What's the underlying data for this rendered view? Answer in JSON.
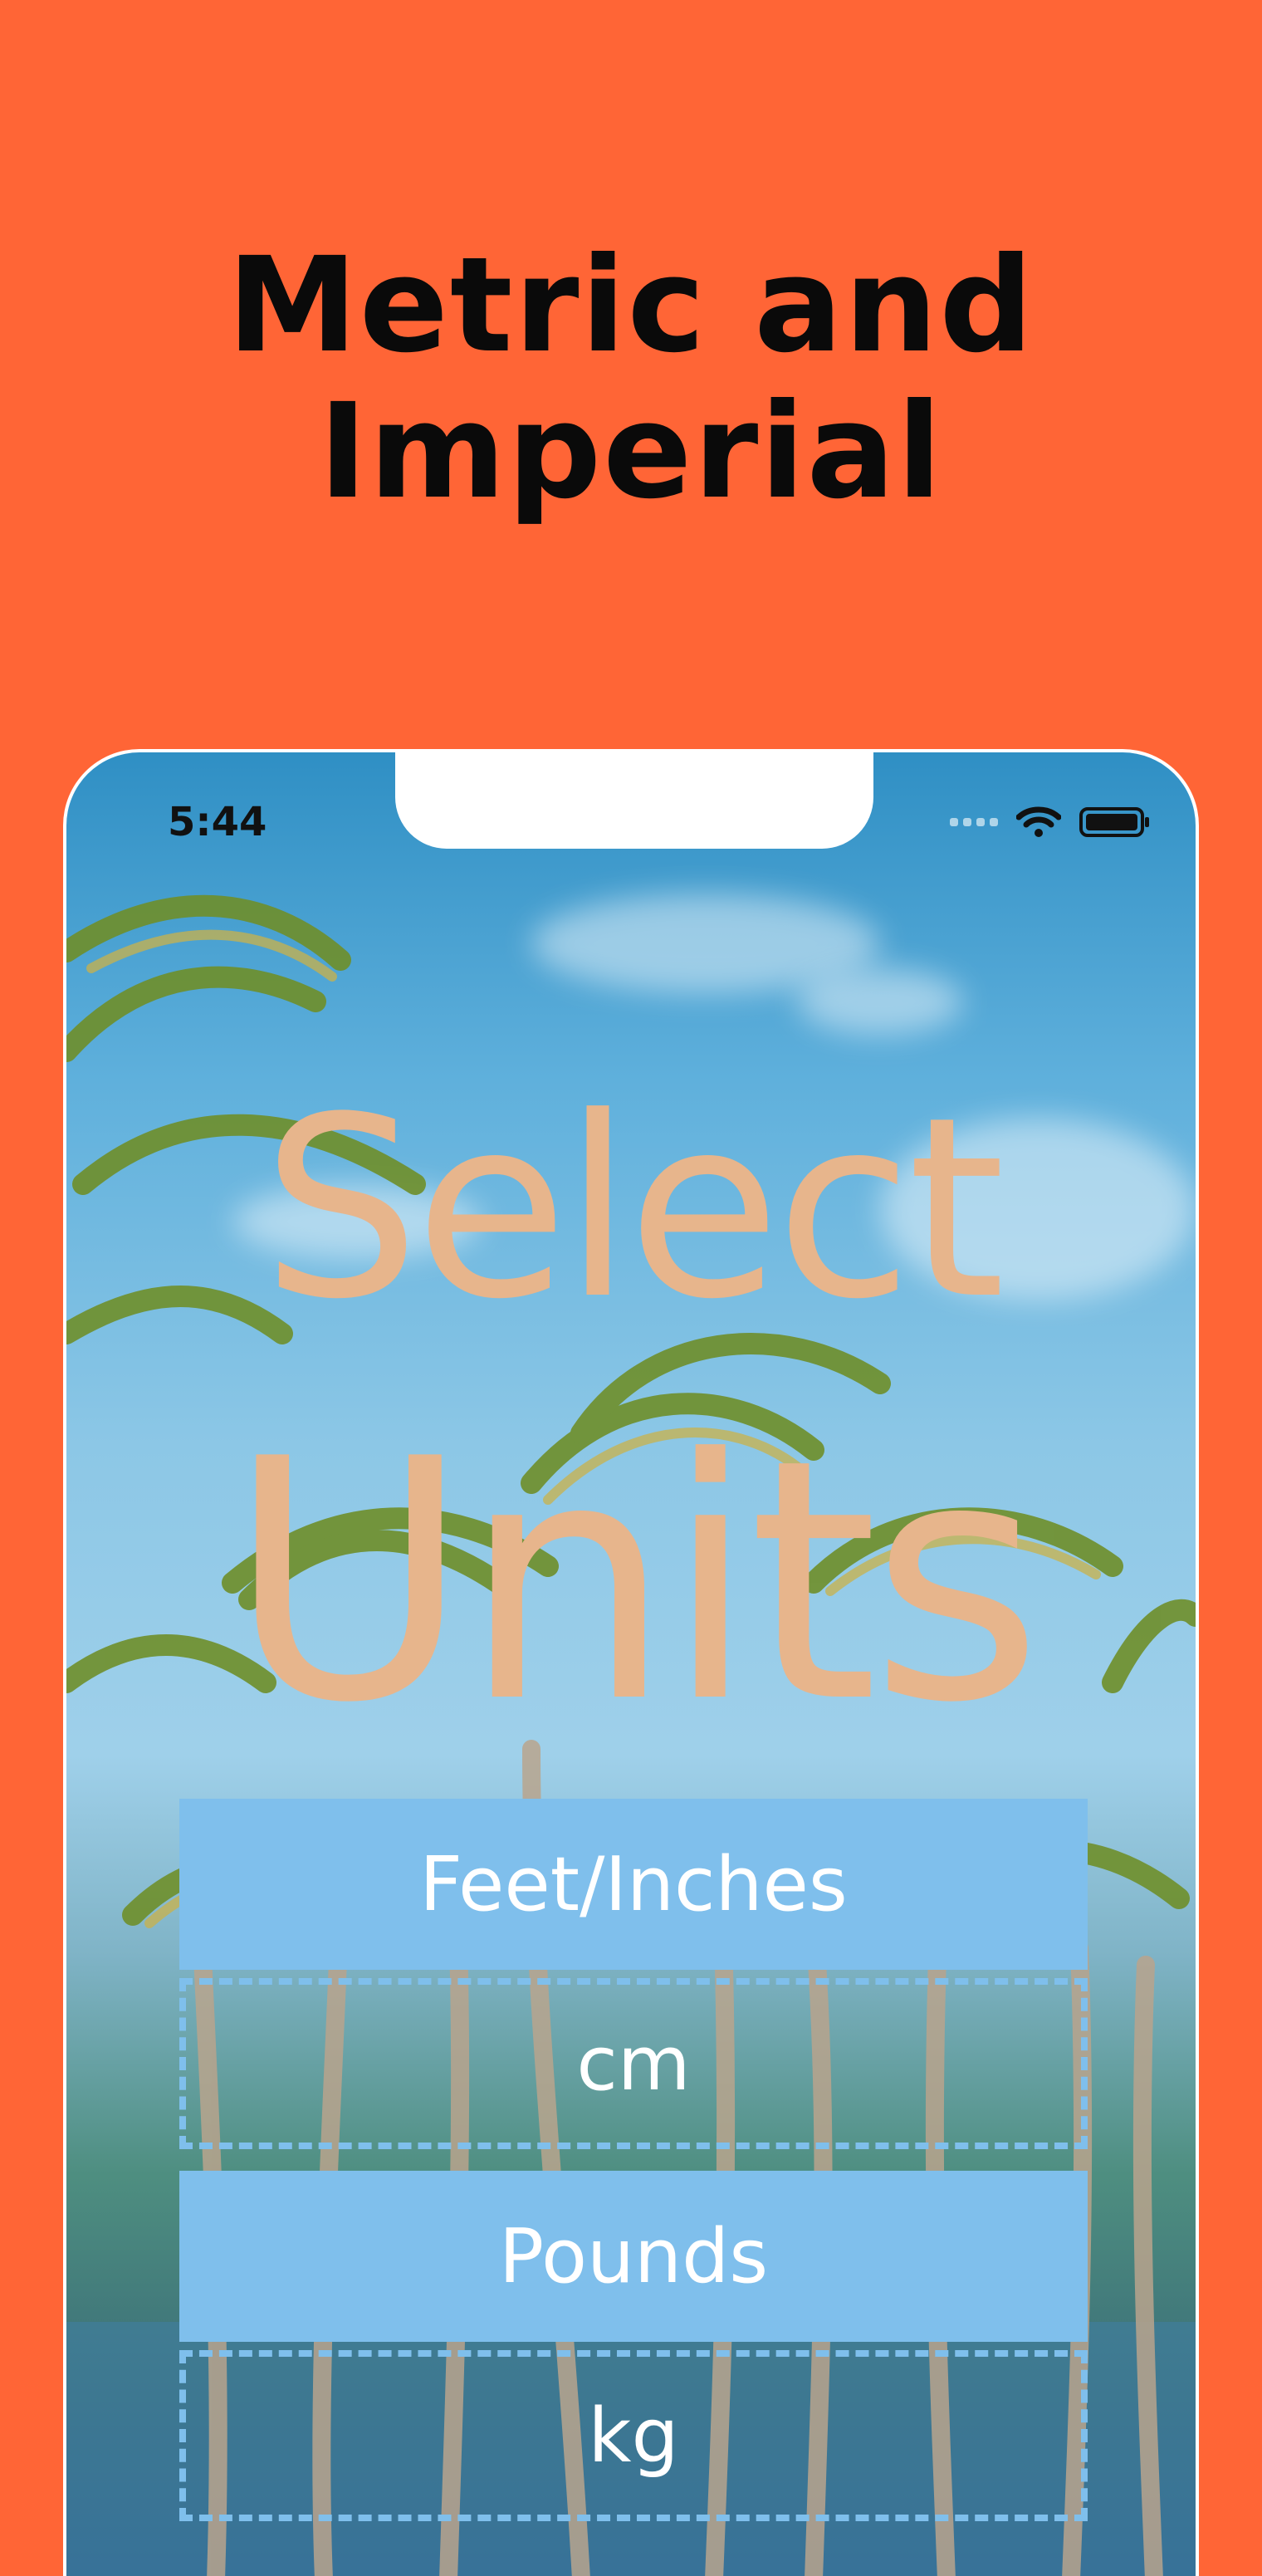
{
  "headline": {
    "line1": "Metric and",
    "line2": "Imperial"
  },
  "status_bar": {
    "time": "5:44",
    "icons": [
      "cellular-signal-icon",
      "wifi-icon",
      "battery-icon"
    ]
  },
  "screen": {
    "title_word_1": "Select",
    "title_word_2": "Units",
    "options": [
      {
        "label": "Feet/Inches",
        "selected": true
      },
      {
        "label": "cm",
        "selected": false
      },
      {
        "label": "Pounds",
        "selected": true
      },
      {
        "label": "kg",
        "selected": false
      }
    ]
  },
  "colors": {
    "background": "#FF6536",
    "title_text": "#E7B58C",
    "button_fill": "#7FBFEC",
    "headline_text": "#0a0a0a"
  }
}
